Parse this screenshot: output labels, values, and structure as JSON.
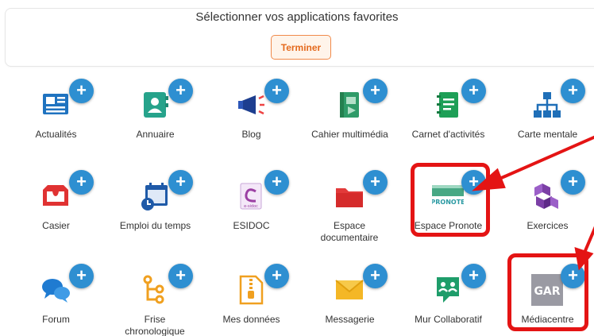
{
  "header": {
    "title": "Sélectionner vos applications favorites",
    "done_label": "Terminer"
  },
  "add_symbol": "+",
  "apps": [
    {
      "label": "Actualités",
      "icon": "newspaper-icon"
    },
    {
      "label": "Annuaire",
      "icon": "address-book-icon"
    },
    {
      "label": "Blog",
      "icon": "megaphone-icon"
    },
    {
      "label": "Cahier multimédia",
      "icon": "notebook-media-icon"
    },
    {
      "label": "Carnet d'activités",
      "icon": "notepad-icon"
    },
    {
      "label": "Carte mentale",
      "icon": "sitemap-icon"
    },
    {
      "label": "Casier",
      "icon": "inbox-tray-icon"
    },
    {
      "label": "Emploi du temps",
      "icon": "calendar-clock-icon"
    },
    {
      "label": "ESIDOC",
      "icon": "esidoc-logo-icon",
      "logo_text": "e-sidoc"
    },
    {
      "label": "Espace documentaire",
      "icon": "folder-icon"
    },
    {
      "label": "Espace Pronote",
      "icon": "pronote-logo-icon",
      "logo_text": "PRONOTE"
    },
    {
      "label": "Exercices",
      "icon": "cubes-icon"
    },
    {
      "label": "Forum",
      "icon": "chat-bubbles-icon"
    },
    {
      "label": "Frise chronologique",
      "icon": "timeline-icon"
    },
    {
      "label": "Mes données",
      "icon": "zip-file-icon"
    },
    {
      "label": "Messagerie",
      "icon": "envelope-icon"
    },
    {
      "label": "Mur Collaboratif",
      "icon": "collab-wall-icon"
    },
    {
      "label": "Médiacentre",
      "icon": "gar-logo-icon",
      "logo_text": "GAR"
    }
  ],
  "colors": {
    "add_button": "#2e8fd1",
    "highlight": "#e41414",
    "done_border": "#f08a4b"
  }
}
